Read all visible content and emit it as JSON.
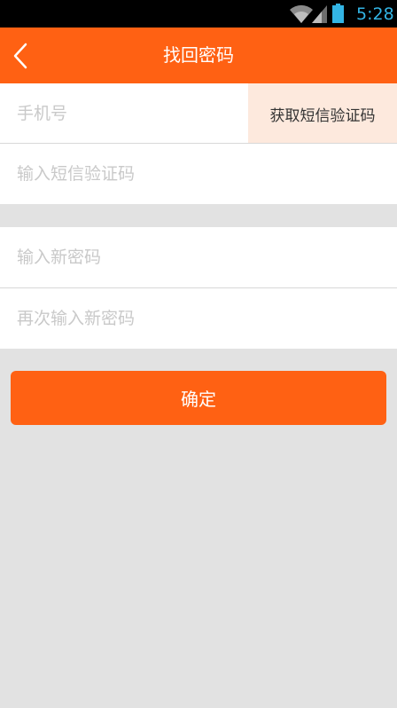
{
  "status_bar": {
    "time": "5:28",
    "icons": [
      "wifi-icon",
      "signal-icon",
      "battery-icon"
    ],
    "time_color": "#33b5e5"
  },
  "header": {
    "title": "找回密码",
    "back_icon": "chevron-left-icon",
    "background": "#ff6113"
  },
  "form": {
    "phone_placeholder": "手机号",
    "get_code_label": "获取短信验证码",
    "sms_code_placeholder": "输入短信验证码",
    "new_password_placeholder": "输入新密码",
    "confirm_password_placeholder": "再次输入新密码"
  },
  "confirm_button": {
    "label": "确定"
  },
  "colors": {
    "accent": "#ff6113",
    "background": "#e2e2e2",
    "get_code_bg": "#fde9dd",
    "placeholder": "#c9c9c9"
  }
}
